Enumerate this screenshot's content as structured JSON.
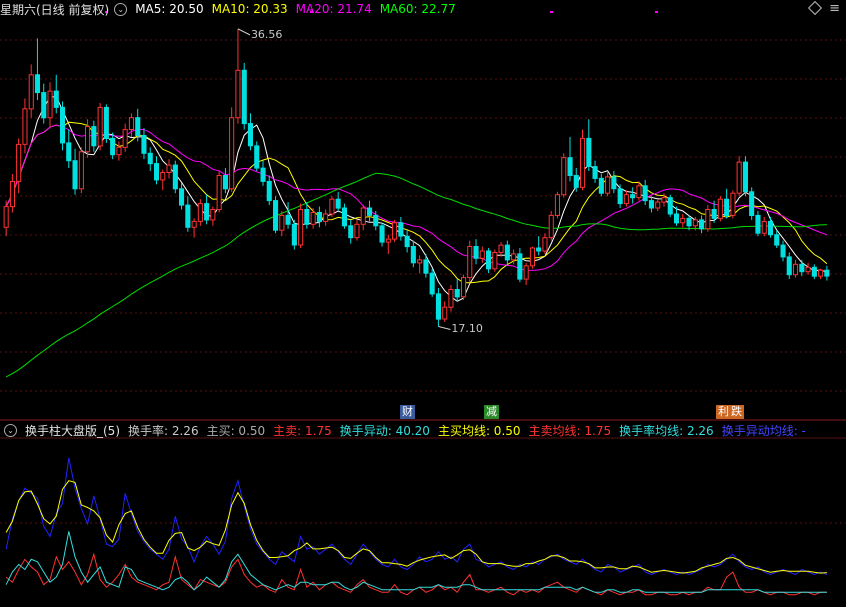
{
  "header": {
    "period": "星期六(日线 前复权)",
    "ma": [
      {
        "label": "MA5: 20.50",
        "color": "#ffffff"
      },
      {
        "label": "MA10: 20.33",
        "color": "#ffff00"
      },
      {
        "label": "MA20: 21.74",
        "color": "#ff00ff"
      },
      {
        "label": "MA60: 22.77",
        "color": "#00ff00"
      }
    ]
  },
  "sub_header": {
    "indicator": "换手柱大盘版_(5)",
    "values": [
      {
        "label": "换手率: 2.26",
        "color": "#aaaaaa"
      },
      {
        "label": "主买: 0.50",
        "color": "#ff3333"
      },
      {
        "label": "主卖: 1.75",
        "color": "#33dddd"
      },
      {
        "label": "换手异动: 40.20",
        "color": "#ffff00"
      },
      {
        "label": "主买均线: 0.50",
        "color": "#ff3333"
      },
      {
        "label": "主卖均线: 1.75",
        "color": "#33dddd"
      },
      {
        "label": "换手率均线: 2.26",
        "color": "#4444ff"
      },
      {
        "label": "换手异动均线: -",
        "color": "#ffff00"
      }
    ]
  },
  "events": [
    {
      "text": "财",
      "bg": "#3a5a9a",
      "color": "#ffffff",
      "x": 400
    },
    {
      "text": "减",
      "bg": "#2a8a2a",
      "color": "#ffffff",
      "x": 484
    },
    {
      "text": "利",
      "bg": "#cc6622",
      "color": "#ffffff",
      "x": 716
    },
    {
      "text": "跌",
      "bg": "#cc6622",
      "color": "#ffffff",
      "x": 729
    }
  ],
  "annotations": {
    "high": "36.56",
    "low": "17.10"
  },
  "chart_data": {
    "type": "candlestick",
    "ylim": [
      12.0,
      37.8
    ],
    "candles": [
      [
        23.8,
        25.6,
        23.2,
        25.2
      ],
      [
        25.2,
        27.4,
        24.8,
        26.9
      ],
      [
        26.9,
        29.8,
        26.1,
        29.4
      ],
      [
        29.4,
        32.5,
        28.8,
        31.8
      ],
      [
        31.8,
        34.8,
        31.2,
        34.1
      ],
      [
        34.1,
        36.56,
        32.4,
        32.9
      ],
      [
        32.9,
        33.5,
        30.8,
        31.2
      ],
      [
        31.2,
        33.6,
        30.6,
        33.0
      ],
      [
        33.0,
        34.1,
        31.5,
        31.9
      ],
      [
        31.9,
        32.3,
        29.0,
        29.5
      ],
      [
        29.5,
        30.4,
        27.8,
        28.3
      ],
      [
        28.3,
        29.1,
        26.0,
        26.4
      ],
      [
        26.4,
        29.2,
        26.1,
        28.9
      ],
      [
        28.9,
        31.1,
        28.5,
        30.6
      ],
      [
        30.6,
        31.0,
        28.9,
        29.3
      ],
      [
        29.3,
        32.2,
        29.0,
        31.9
      ],
      [
        31.9,
        32.1,
        29.5,
        29.8
      ],
      [
        29.8,
        30.2,
        28.4,
        28.7
      ],
      [
        28.7,
        29.6,
        28.3,
        29.2
      ],
      [
        29.2,
        30.8,
        28.9,
        30.4
      ],
      [
        30.4,
        31.5,
        29.9,
        31.2
      ],
      [
        31.2,
        31.8,
        29.6,
        30.0
      ],
      [
        30.0,
        30.5,
        28.4,
        28.8
      ],
      [
        28.8,
        29.2,
        27.6,
        28.1
      ],
      [
        28.1,
        28.6,
        26.7,
        27.0
      ],
      [
        27.0,
        27.7,
        26.3,
        27.5
      ],
      [
        27.5,
        28.4,
        27.1,
        28.0
      ],
      [
        28.0,
        28.3,
        26.1,
        26.4
      ],
      [
        26.4,
        26.8,
        25.0,
        25.3
      ],
      [
        25.3,
        25.9,
        23.5,
        23.8
      ],
      [
        23.8,
        24.4,
        23.1,
        24.2
      ],
      [
        24.2,
        25.7,
        23.9,
        25.4
      ],
      [
        25.4,
        26.0,
        24.0,
        24.3
      ],
      [
        24.3,
        25.2,
        23.9,
        25.0
      ],
      [
        25.0,
        27.6,
        24.8,
        27.3
      ],
      [
        27.3,
        27.8,
        26.1,
        26.4
      ],
      [
        26.4,
        31.9,
        26.2,
        31.2
      ],
      [
        31.2,
        37.2,
        30.8,
        34.4
      ],
      [
        34.4,
        34.9,
        30.4,
        30.8
      ],
      [
        30.8,
        31.5,
        29.0,
        29.3
      ],
      [
        29.3,
        29.6,
        27.6,
        27.8
      ],
      [
        27.8,
        28.3,
        26.6,
        26.9
      ],
      [
        26.9,
        27.3,
        25.3,
        25.6
      ],
      [
        25.6,
        25.9,
        23.4,
        23.6
      ],
      [
        23.6,
        24.9,
        23.2,
        24.6
      ],
      [
        24.6,
        25.5,
        23.7,
        24.0
      ],
      [
        24.0,
        24.3,
        22.3,
        22.6
      ],
      [
        22.6,
        25.4,
        22.4,
        25.0
      ],
      [
        25.0,
        25.5,
        23.7,
        24.0
      ],
      [
        24.0,
        25.1,
        23.7,
        24.8
      ],
      [
        24.8,
        25.2,
        23.8,
        24.2
      ],
      [
        24.2,
        25.0,
        23.9,
        24.7
      ],
      [
        24.7,
        25.9,
        24.5,
        25.7
      ],
      [
        25.7,
        26.2,
        24.9,
        25.1
      ],
      [
        25.1,
        25.4,
        23.7,
        23.9
      ],
      [
        23.9,
        24.3,
        22.7,
        23.1
      ],
      [
        23.1,
        24.3,
        22.9,
        24.0
      ],
      [
        24.0,
        25.3,
        23.6,
        25.1
      ],
      [
        25.1,
        25.6,
        24.2,
        24.6
      ],
      [
        24.6,
        24.9,
        23.6,
        23.9
      ],
      [
        23.9,
        24.1,
        22.5,
        22.8
      ],
      [
        22.8,
        23.3,
        22.0,
        23.0
      ],
      [
        23.0,
        24.3,
        22.8,
        24.1
      ],
      [
        24.1,
        24.5,
        22.9,
        23.2
      ],
      [
        23.2,
        23.6,
        22.1,
        22.5
      ],
      [
        22.5,
        22.9,
        21.1,
        21.4
      ],
      [
        21.4,
        21.9,
        20.7,
        21.6
      ],
      [
        21.6,
        22.0,
        20.4,
        20.7
      ],
      [
        20.7,
        21.0,
        19.1,
        19.3
      ],
      [
        19.3,
        19.7,
        17.1,
        17.6
      ],
      [
        17.6,
        18.8,
        17.4,
        18.4
      ],
      [
        18.4,
        19.9,
        18.1,
        19.6
      ],
      [
        19.6,
        20.3,
        18.8,
        19.1
      ],
      [
        19.1,
        20.6,
        18.9,
        20.4
      ],
      [
        20.4,
        22.9,
        20.1,
        22.5
      ],
      [
        22.5,
        23.0,
        21.3,
        21.7
      ],
      [
        21.7,
        22.5,
        21.4,
        22.2
      ],
      [
        22.2,
        22.4,
        20.7,
        21.0
      ],
      [
        21.0,
        22.3,
        20.8,
        22.1
      ],
      [
        22.1,
        22.8,
        21.8,
        22.6
      ],
      [
        22.6,
        22.9,
        21.2,
        21.6
      ],
      [
        21.6,
        22.3,
        21.3,
        22.0
      ],
      [
        22.0,
        22.4,
        20.1,
        20.3
      ],
      [
        20.3,
        21.4,
        19.9,
        21.2
      ],
      [
        21.2,
        22.5,
        21.0,
        22.4
      ],
      [
        22.4,
        23.2,
        21.9,
        22.2
      ],
      [
        22.2,
        23.4,
        22.0,
        23.1
      ],
      [
        23.1,
        24.9,
        22.9,
        24.6
      ],
      [
        24.6,
        26.2,
        24.4,
        26.0
      ],
      [
        26.0,
        28.8,
        25.8,
        28.5
      ],
      [
        28.5,
        29.9,
        26.9,
        27.3
      ],
      [
        27.3,
        27.8,
        26.2,
        26.5
      ],
      [
        26.5,
        30.4,
        26.3,
        29.8
      ],
      [
        29.8,
        31.1,
        27.6,
        27.9
      ],
      [
        27.9,
        28.3,
        26.8,
        27.1
      ],
      [
        27.1,
        27.4,
        25.9,
        26.1
      ],
      [
        26.1,
        27.5,
        25.9,
        27.2
      ],
      [
        27.2,
        27.6,
        26.1,
        26.4
      ],
      [
        26.4,
        26.7,
        25.1,
        25.4
      ],
      [
        25.4,
        26.3,
        25.2,
        26.0
      ],
      [
        26.0,
        26.5,
        25.4,
        25.8
      ],
      [
        25.8,
        26.9,
        25.6,
        26.6
      ],
      [
        26.6,
        27.0,
        25.3,
        25.6
      ],
      [
        25.6,
        25.9,
        24.8,
        25.1
      ],
      [
        25.1,
        25.7,
        24.9,
        25.5
      ],
      [
        25.5,
        26.1,
        25.2,
        25.8
      ],
      [
        25.8,
        26.0,
        24.5,
        24.7
      ],
      [
        24.7,
        25.2,
        23.9,
        24.1
      ],
      [
        24.1,
        24.7,
        23.8,
        24.4
      ],
      [
        24.4,
        24.6,
        23.6,
        23.9
      ],
      [
        23.9,
        24.5,
        23.6,
        24.3
      ],
      [
        24.3,
        24.6,
        23.4,
        23.7
      ],
      [
        23.7,
        25.3,
        23.5,
        25.0
      ],
      [
        25.0,
        25.6,
        24.1,
        24.4
      ],
      [
        24.4,
        25.9,
        24.2,
        25.7
      ],
      [
        25.7,
        26.4,
        24.4,
        24.6
      ],
      [
        24.6,
        26.3,
        24.4,
        26.1
      ],
      [
        26.1,
        28.6,
        25.9,
        28.2
      ],
      [
        28.2,
        28.6,
        25.9,
        26.2
      ],
      [
        26.2,
        26.5,
        24.3,
        24.6
      ],
      [
        24.6,
        24.9,
        23.2,
        23.4
      ],
      [
        23.4,
        24.5,
        23.2,
        24.2
      ],
      [
        24.2,
        24.5,
        23.1,
        23.3
      ],
      [
        23.3,
        23.6,
        22.4,
        22.6
      ],
      [
        22.6,
        22.9,
        21.5,
        21.8
      ],
      [
        21.8,
        22.1,
        20.3,
        20.6
      ],
      [
        20.6,
        21.6,
        20.4,
        21.3
      ],
      [
        21.3,
        21.6,
        20.5,
        20.8
      ],
      [
        20.8,
        21.4,
        20.6,
        21.1
      ],
      [
        21.1,
        21.3,
        20.3,
        20.5
      ],
      [
        20.5,
        21.0,
        20.3,
        20.9
      ],
      [
        20.9,
        21.2,
        20.2,
        20.5
      ]
    ]
  },
  "volume_data": {
    "turnover": [
      2.2,
      3.4,
      4.1,
      4.6,
      4.4,
      4.2,
      3.1,
      2.7,
      3.6,
      4.0,
      5.8,
      4.6,
      3.8,
      3.2,
      4.3,
      3.4,
      2.4,
      2.3,
      2.6,
      4.4,
      3.6,
      2.9,
      2.5,
      2.2,
      2.0,
      1.8,
      2.2,
      3.5,
      2.6,
      2.3,
      1.7,
      2.3,
      2.7,
      2.4,
      2.0,
      2.5,
      4.2,
      4.9,
      3.9,
      3.0,
      2.4,
      2.1,
      1.8,
      1.6,
      2.1,
      1.9,
      1.7,
      2.7,
      2.2,
      2.3,
      2.0,
      2.2,
      2.4,
      2.1,
      1.8,
      1.6,
      2.0,
      2.4,
      2.1,
      1.8,
      1.6,
      1.5,
      1.8,
      1.5,
      1.4,
      1.6,
      1.9,
      1.7,
      1.8,
      2.1,
      1.8,
      1.9,
      1.7,
      2.2,
      2.4,
      1.8,
      1.7,
      1.5,
      1.6,
      1.7,
      1.5,
      1.4,
      1.6,
      1.5,
      1.7,
      1.6,
      1.8,
      1.9,
      2.0,
      1.8,
      1.7,
      1.6,
      1.8,
      1.6,
      1.4,
      1.3,
      1.6,
      1.5,
      1.3,
      1.4,
      1.5,
      1.6,
      1.3,
      1.2,
      1.3,
      1.4,
      1.3,
      1.2,
      1.3,
      1.2,
      1.3,
      1.4,
      1.6,
      1.5,
      1.6,
      1.8,
      2.0,
      1.7,
      1.5,
      1.4,
      1.5,
      1.3,
      1.2,
      1.3,
      1.4,
      1.3,
      1.2,
      1.4,
      1.3,
      1.2,
      1.3,
      1.2
    ],
    "main_buy": [
      1.1,
      0.9,
      1.4,
      1.8,
      1.5,
      1.3,
      0.8,
      1.0,
      1.9,
      1.4,
      1.7,
      1.3,
      0.8,
      1.2,
      2.0,
      1.0,
      0.7,
      0.9,
      1.2,
      1.6,
      1.1,
      0.9,
      0.8,
      0.7,
      0.6,
      0.8,
      0.9,
      1.9,
      1.0,
      0.8,
      0.6,
      1.0,
      0.9,
      0.8,
      0.7,
      0.9,
      1.5,
      1.8,
      1.2,
      0.9,
      0.7,
      0.8,
      0.6,
      0.5,
      1.0,
      0.7,
      0.6,
      1.4,
      0.7,
      0.9,
      0.6,
      0.8,
      0.9,
      0.7,
      0.6,
      0.5,
      0.8,
      1.0,
      0.7,
      0.6,
      0.5,
      0.5,
      0.8,
      0.5,
      0.4,
      0.6,
      0.7,
      0.5,
      0.6,
      0.8,
      0.6,
      0.7,
      0.5,
      0.9,
      1.2,
      0.6,
      0.6,
      0.5,
      0.6,
      0.7,
      0.5,
      0.4,
      0.6,
      0.5,
      0.6,
      0.5,
      0.7,
      0.8,
      0.9,
      0.7,
      0.6,
      0.5,
      0.7,
      0.6,
      0.5,
      0.4,
      0.6,
      0.5,
      0.4,
      0.5,
      0.5,
      0.6,
      0.4,
      0.4,
      0.5,
      0.5,
      0.4,
      0.4,
      0.5,
      0.4,
      0.5,
      0.5,
      0.7,
      0.6,
      0.6,
      1.1,
      1.3,
      0.7,
      0.5,
      0.5,
      0.6,
      0.5,
      0.4,
      0.5,
      0.5,
      0.4,
      0.4,
      0.5,
      0.5,
      0.4,
      0.5,
      0.5
    ],
    "main_sell": [
      0.8,
      1.3,
      1.6,
      1.4,
      1.8,
      1.7,
      1.3,
      0.9,
      1.1,
      1.6,
      2.9,
      1.9,
      1.3,
      0.9,
      1.2,
      1.5,
      0.9,
      0.8,
      0.7,
      1.5,
      1.4,
      1.0,
      0.9,
      0.8,
      0.7,
      0.6,
      0.7,
      1.0,
      1.1,
      0.9,
      0.6,
      0.8,
      1.1,
      0.9,
      0.7,
      1.0,
      1.7,
      2.0,
      1.6,
      1.2,
      1.0,
      0.8,
      0.7,
      0.6,
      0.7,
      0.8,
      0.7,
      0.9,
      0.9,
      0.8,
      0.8,
      0.8,
      0.9,
      0.9,
      0.7,
      0.6,
      0.7,
      0.9,
      0.8,
      0.7,
      0.6,
      0.6,
      0.6,
      0.6,
      0.6,
      0.6,
      0.7,
      0.7,
      0.7,
      0.8,
      0.7,
      0.7,
      0.7,
      0.8,
      0.8,
      0.7,
      0.6,
      0.6,
      0.6,
      0.6,
      0.6,
      0.6,
      0.6,
      0.6,
      0.6,
      0.6,
      0.7,
      0.7,
      0.7,
      0.7,
      0.7,
      0.6,
      0.7,
      0.6,
      0.5,
      0.5,
      0.6,
      0.6,
      0.5,
      0.5,
      0.6,
      0.6,
      0.5,
      0.5,
      0.5,
      0.5,
      0.5,
      0.5,
      0.5,
      0.5,
      0.5,
      0.5,
      0.6,
      0.6,
      0.6,
      0.6,
      0.6,
      0.6,
      0.6,
      0.6,
      0.6,
      0.5,
      0.5,
      0.5,
      0.5,
      0.5,
      0.5,
      0.5,
      0.5,
      0.5,
      0.5,
      0.5
    ]
  }
}
